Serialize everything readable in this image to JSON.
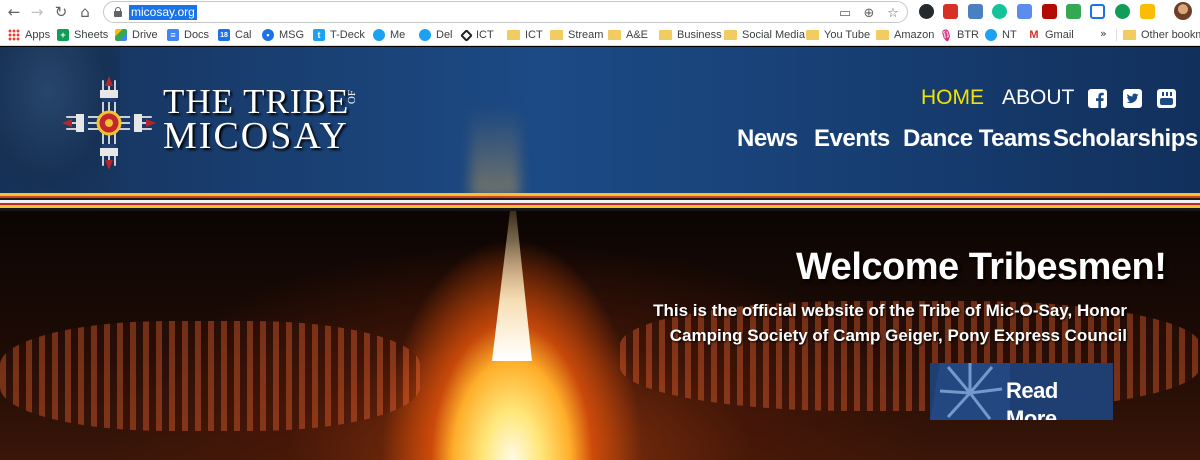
{
  "browser": {
    "url": "micosay.org",
    "bookmarks": [
      "Apps",
      "Sheets",
      "Drive",
      "Docs",
      "Cal",
      "MSG",
      "T-Deck",
      "Me",
      "Del",
      "ICT",
      "ICT",
      "Stream",
      "A&E",
      "Business",
      "Social Media",
      "You Tube",
      "Amazon",
      "BTR",
      "NT",
      "Gmail"
    ],
    "bookmarks_overflow": "»",
    "other_bookmarks": "Other bookmarks",
    "cal_badge": "18"
  },
  "site": {
    "logo": {
      "line1": "THE TRIBE",
      "of": "OF",
      "line2": "MICOSAY"
    },
    "top_nav": [
      "HOME",
      "ABOUT"
    ],
    "social": [
      "facebook-icon",
      "twitter-icon",
      "youtube-icon"
    ],
    "main_nav": [
      "News",
      "Events",
      "Dance Teams",
      "Scholarships"
    ],
    "colors": {
      "header_blue": "#1c4a85",
      "active_nav": "#f3e300",
      "button_blue": "#1f3f73"
    }
  },
  "hero": {
    "title": "Welcome Tribesmen!",
    "text_line1": "This is the official website of the Tribe of Mic-O-Say, Honor",
    "text_line2": "Camping Society of Camp Geiger, Pony Express Council",
    "button": "Read More"
  }
}
